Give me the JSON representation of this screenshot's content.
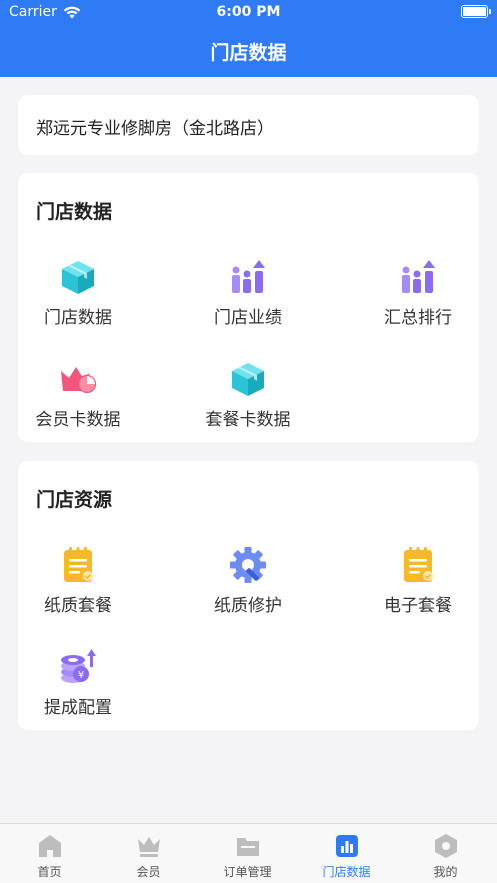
{
  "status_bar": {
    "carrier": "Carrier",
    "time": "6:00 PM"
  },
  "nav": {
    "title": "门店数据"
  },
  "store": {
    "name": "郑远元专业修脚房（金北路店）"
  },
  "data_section": {
    "title": "门店数据",
    "items": [
      {
        "label": "门店数据",
        "icon": "box-icon"
      },
      {
        "label": "门店业绩",
        "icon": "growth-chart-icon"
      },
      {
        "label": "汇总排行",
        "icon": "growth-chart-icon"
      },
      {
        "label": "会员卡数据",
        "icon": "crown-pie-icon"
      },
      {
        "label": "套餐卡数据",
        "icon": "box-icon"
      }
    ]
  },
  "resource_section": {
    "title": "门店资源",
    "items": [
      {
        "label": "纸质套餐",
        "icon": "document-check-icon"
      },
      {
        "label": "纸质修护",
        "icon": "gear-wrench-icon"
      },
      {
        "label": "电子套餐",
        "icon": "document-check-icon"
      },
      {
        "label": "提成配置",
        "icon": "coins-icon"
      }
    ]
  },
  "tabbar": {
    "tabs": [
      {
        "label": "首页",
        "icon": "home-icon"
      },
      {
        "label": "会员",
        "icon": "crown-icon"
      },
      {
        "label": "订单管理",
        "icon": "folder-icon"
      },
      {
        "label": "门店数据",
        "icon": "bar-chart-icon",
        "active": true
      },
      {
        "label": "我的",
        "icon": "hexagon-user-icon"
      }
    ]
  },
  "colors": {
    "primary": "#2f7bf5",
    "teal": "#2bc4d6",
    "purple": "#8b6cf0",
    "pink": "#f5557a",
    "yellow": "#f7b928",
    "tab_inactive": "#bdbdbd"
  }
}
